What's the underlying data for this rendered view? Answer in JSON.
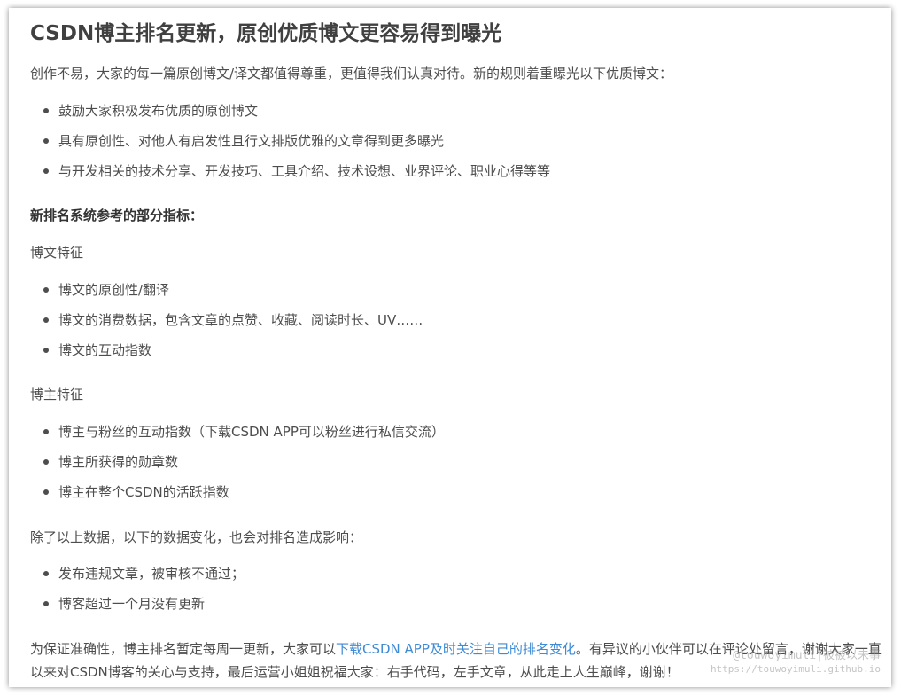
{
  "article": {
    "title": "CSDN博主排名更新，原创优质博文更容易得到曝光",
    "intro": "创作不易，大家的每一篇原创博文/译文都值得尊重，更值得我们认真对待。新的规则着重曝光以下优质博文：",
    "encourage_list": [
      "鼓励大家积极发布优质的原创博文",
      "具有原创性、对他人有启发性且行文排版优雅的文章得到更多曝光",
      "与开发相关的技术分享、开发技巧、工具介绍、技术设想、业界评论、职业心得等等"
    ],
    "metrics_heading": "新排名系统参考的部分指标：",
    "post_features_heading": "博文特征",
    "post_features": [
      "博文的原创性/翻译",
      "博文的消费数据，包含文章的点赞、收藏、阅读时长、UV……",
      "博文的互动指数"
    ],
    "blogger_features_heading": "博主特征",
    "blogger_features": [
      "博主与粉丝的互动指数（下载CSDN APP可以粉丝进行私信交流）",
      "博主所获得的勋章数",
      "博主在整个CSDN的活跃指数"
    ],
    "other_factors_heading": "除了以上数据，以下的数据变化，也会对排名造成影响：",
    "other_factors": [
      "发布违规文章，被审核不通过；",
      "博客超过一个月没有更新"
    ],
    "closing_before_link": "为保证准确性，博主排名暂定每周一更新，大家可以",
    "closing_link": "下载CSDN APP及时关注自己的排名变化",
    "closing_after_link": "。有异议的小伙伴可以在评论处留言，谢谢大家一直以来对CSDN博客的关心与支持，最后运营小姐姐祝福大家：右手代码，左手文章，从此走上人生巅峰，谢谢！"
  },
  "watermark": {
    "line1": "@touwoyimuli|被被以未事",
    "line2": "https://touwoyimuli.github.io"
  },
  "colors": {
    "link": "#3d8ad6",
    "text": "#4d4d4d",
    "title": "#404040"
  }
}
